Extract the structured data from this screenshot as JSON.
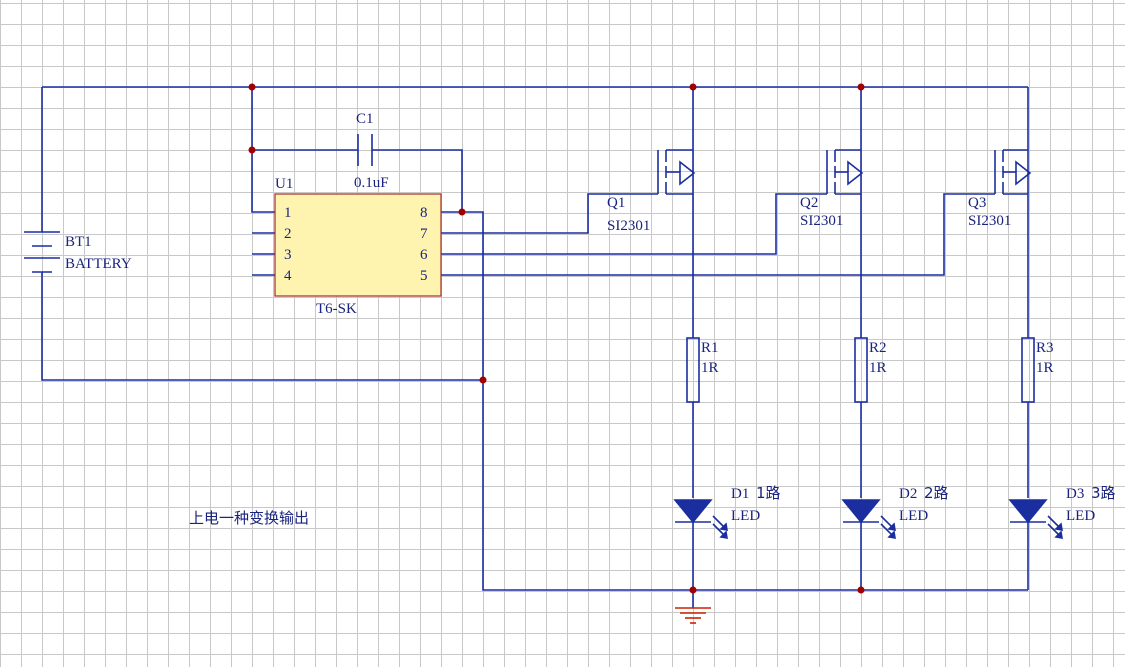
{
  "battery": {
    "ref": "BT1",
    "value": "BATTERY"
  },
  "ic": {
    "ref": "U1",
    "part": "T6-SK",
    "pins": [
      "1",
      "2",
      "3",
      "4",
      "8",
      "7",
      "6",
      "5"
    ]
  },
  "capacitor": {
    "ref": "C1",
    "value": "0.1uF"
  },
  "mosfets": [
    {
      "ref": "Q1",
      "part": "SI2301"
    },
    {
      "ref": "Q2",
      "part": "SI2301"
    },
    {
      "ref": "Q3",
      "part": "SI2301"
    }
  ],
  "resistors": [
    {
      "ref": "R1",
      "value": "1R"
    },
    {
      "ref": "R2",
      "value": "1R"
    },
    {
      "ref": "R3",
      "value": "1R"
    }
  ],
  "leds": [
    {
      "ref": "D1",
      "note": "1路",
      "value": "LED"
    },
    {
      "ref": "D2",
      "note": "2路",
      "value": "LED"
    },
    {
      "ref": "D3",
      "note": "3路",
      "value": "LED"
    }
  ],
  "note": "上电一种变换输出",
  "colors": {
    "wire": "#1a2ea0",
    "junction": "#a00000",
    "ic_fill": "#fff3b0",
    "ground": "#cc2200",
    "grid": "#c8c8c8"
  }
}
